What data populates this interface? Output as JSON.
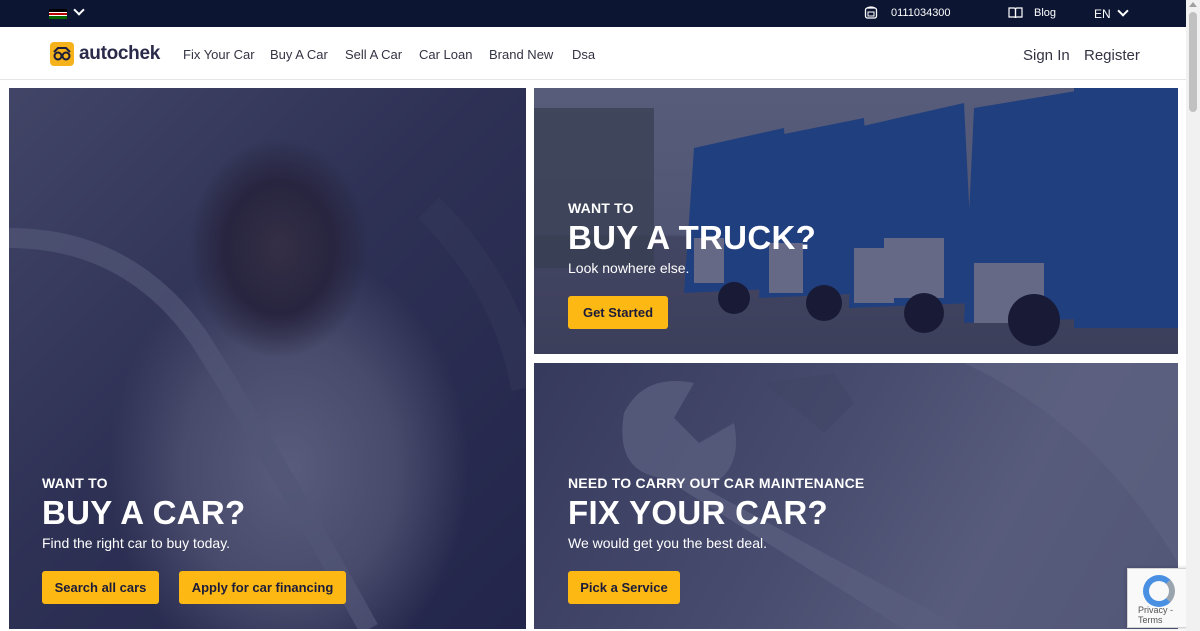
{
  "topbar": {
    "phone": "0111034300",
    "blog": "Blog",
    "language": "EN",
    "flag_colors": [
      "#000000",
      "#bb0000",
      "#006600"
    ]
  },
  "nav": {
    "logo": "autochek",
    "links": [
      "Fix Your Car",
      "Buy A Car",
      "Sell A Car",
      "Car Loan",
      "Brand New",
      "Dsa"
    ],
    "sign_in": "Sign In",
    "register": "Register"
  },
  "hero": {
    "buy_car": {
      "eyebrow": "WANT TO",
      "headline": "BUY A CAR?",
      "sub": "Find the right car to buy today.",
      "button_primary": "Search all cars",
      "button_secondary": "Apply for car financing"
    },
    "buy_truck": {
      "eyebrow": "WANT TO",
      "headline": "BUY A TRUCK?",
      "sub": "Look nowhere else.",
      "button": "Get Started"
    },
    "fix_car": {
      "eyebrow": "NEED TO CARRY OUT CAR MAINTENANCE",
      "headline": "FIX YOUR CAR?",
      "sub": "We would get you the best deal.",
      "button": "Pick a Service"
    }
  },
  "recaptcha": {
    "privacy": "Privacy",
    "terms": "Terms"
  },
  "colors": {
    "accent": "#fdb813",
    "topbar_bg": "#0c1633",
    "overlay": "#141846"
  }
}
